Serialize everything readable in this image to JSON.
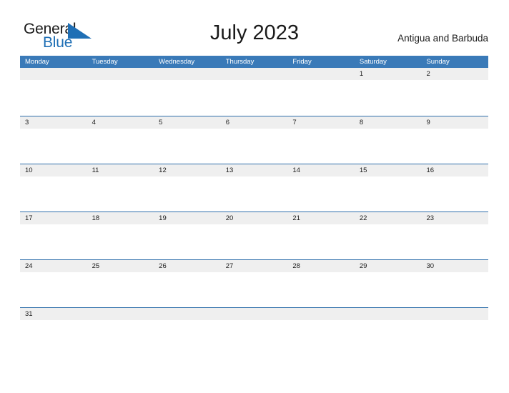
{
  "brand": {
    "word_one": "General",
    "word_two": "Blue",
    "mark_icon": "blue-triangle-flag-icon",
    "accent_color": "#1f6fb5"
  },
  "header": {
    "title": "July 2023",
    "region": "Antigua and Barbuda"
  },
  "theme": {
    "header_blue": "#3a7ab8",
    "rule_blue": "#2f6fab",
    "band_gray": "#efefef",
    "text_dark": "#1a1a1a"
  },
  "calendar": {
    "month": "July",
    "year": "2023",
    "weekday_headers": [
      "Monday",
      "Tuesday",
      "Wednesday",
      "Thursday",
      "Friday",
      "Saturday",
      "Sunday"
    ],
    "weeks": [
      [
        "",
        "",
        "",
        "",
        "",
        "1",
        "2"
      ],
      [
        "3",
        "4",
        "5",
        "6",
        "7",
        "8",
        "9"
      ],
      [
        "10",
        "11",
        "12",
        "13",
        "14",
        "15",
        "16"
      ],
      [
        "17",
        "18",
        "19",
        "20",
        "21",
        "22",
        "23"
      ],
      [
        "24",
        "25",
        "26",
        "27",
        "28",
        "29",
        "30"
      ],
      [
        "31",
        "",
        "",
        "",
        "",
        "",
        ""
      ]
    ]
  }
}
